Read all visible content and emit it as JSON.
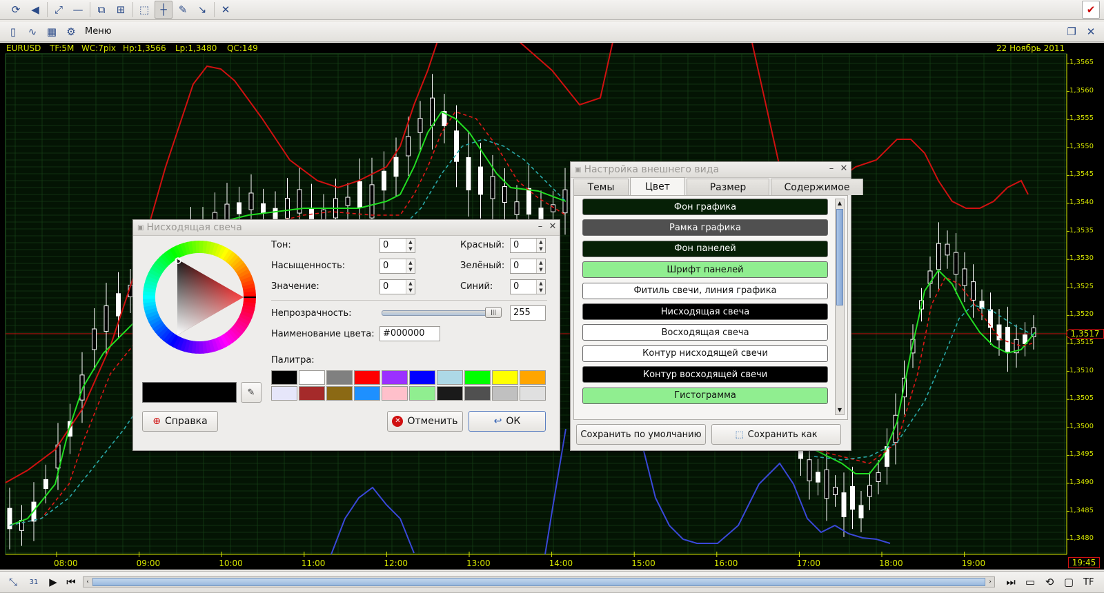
{
  "toolbar": {
    "icons": [
      "refresh-icon",
      "sound-icon",
      "fit-icon",
      "line-icon",
      "new-window-icon",
      "add-window-icon",
      "select-icon",
      "crosshair-icon",
      "draw-icon",
      "trend-icon",
      "close-icon"
    ],
    "checkbox_icon": "check-icon"
  },
  "menubar": {
    "menu_label": "Меню"
  },
  "chart": {
    "symbol": "EURUSD",
    "timeframe": "TF:5M",
    "wc": "WC:7pix",
    "hp": "Hp:1,3566",
    "lp": "Lp:1,3480",
    "qc": "QC:149",
    "date": "22 Ноябрь 2011",
    "price_labels": [
      "1,3565",
      "1,3560",
      "1,3555",
      "1,3550",
      "1,3545",
      "1,3540",
      "1,3535",
      "1,3530",
      "1,3525",
      "1,3520",
      "1,3515",
      "1,3510",
      "1,3505",
      "1,3500",
      "1,3495",
      "1,3490",
      "1,3485",
      "1,3480"
    ],
    "current_price": "1,3517",
    "time_labels": [
      "08:00",
      "09:00",
      "10:00",
      "11:00",
      "12:00",
      "13:00",
      "14:00",
      "15:00",
      "16:00",
      "17:00",
      "18:00",
      "19:00"
    ],
    "current_time": "19:45",
    "colors": {
      "background": "#000000",
      "grid": "#1e4a1e",
      "upper_band": "#d01010",
      "lower_band": "#3a48d8",
      "ma_fast": "#22dd22",
      "ma_dashed_red": "#e01818",
      "ma_dashed_teal": "#2aa8a8",
      "text": "#d4e400"
    }
  },
  "statusbar": {
    "tf_label": "TF"
  },
  "color_dialog": {
    "title": "Нисходящая свеча",
    "hue_label": "Тон:",
    "hue": "0",
    "saturation_label": "Насыщенность:",
    "saturation": "0",
    "value_label": "Значение:",
    "value": "0",
    "red_label": "Красный:",
    "red": "0",
    "green_label": "Зелёный:",
    "green": "0",
    "blue_label": "Синий:",
    "blue": "0",
    "opacity_label": "Непрозрачность:",
    "opacity": "255",
    "color_name_label": "Наименование цвета:",
    "color_name": "#000000",
    "palette_label": "Палитра:",
    "palette": [
      "#000000",
      "#ffffff",
      "#808080",
      "#ff0000",
      "#9b30ff",
      "#0000ff",
      "#add8e6",
      "#00ff00",
      "#ffff00",
      "#ffa500",
      "#e6e6fa",
      "#a52a2a",
      "#8b6914",
      "#1e90ff",
      "#ffc0cb",
      "#90ee90",
      "#1a1a1a",
      "#505050",
      "#c0c0c0",
      "#e0e0e0"
    ],
    "help_button": "Справка",
    "cancel_button": "Отменить",
    "ok_button": "ОК"
  },
  "appearance_dialog": {
    "title": "Настройка внешнего вида",
    "tabs": [
      "Темы",
      "Цвет",
      "Размер",
      "Содержимое"
    ],
    "items": [
      {
        "label": "Фон графика",
        "bg": "#062006",
        "fg": "#ffffff"
      },
      {
        "label": "Рамка графика",
        "bg": "#505050",
        "fg": "#ffffff"
      },
      {
        "label": "Фон панелей",
        "bg": "#062006",
        "fg": "#ffffff"
      },
      {
        "label": "Шрифт панелей",
        "bg": "#90ee90",
        "fg": "#111111"
      },
      {
        "label": "Фитиль свечи, линия графика",
        "bg": "#ffffff",
        "fg": "#111111"
      },
      {
        "label": "Нисходящая свеча",
        "bg": "#000000",
        "fg": "#ffffff"
      },
      {
        "label": "Восходящая свеча",
        "bg": "#ffffff",
        "fg": "#111111"
      },
      {
        "label": "Контур нисходящей свечи",
        "bg": "#ffffff",
        "fg": "#111111"
      },
      {
        "label": "Контур восходящей свечи",
        "bg": "#000000",
        "fg": "#ffffff"
      },
      {
        "label": "Гистограмма",
        "bg": "#90ee90",
        "fg": "#111111"
      }
    ],
    "save_default_button": "Сохранить по умолчанию",
    "save_as_button": "Сохранить как"
  }
}
